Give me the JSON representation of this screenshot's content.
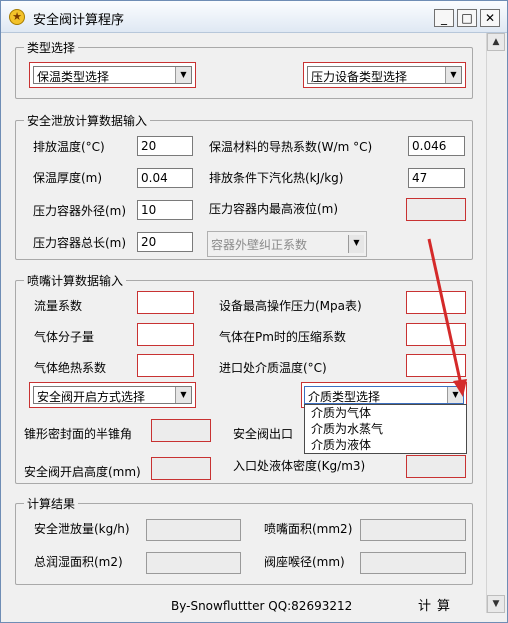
{
  "window": {
    "title": "安全阀计算程序",
    "minimize": "_",
    "maximize": "□",
    "close": "✕"
  },
  "type_group": {
    "title": "类型选择",
    "insulation_combo": "保温类型选择",
    "vessel_combo": "压力设备类型选择"
  },
  "relief_group": {
    "title": "安全泄放计算数据输入",
    "discharge_temp_label": "排放温度(°C)",
    "discharge_temp_value": "20",
    "conductivity_label": "保温材料的导热系数(W/m °C)",
    "conductivity_value": "0.046",
    "insulation_thickness_label": "保温厚度(m)",
    "insulation_thickness_value": "0.04",
    "latent_heat_label": "排放条件下汽化热(kJ/kg)",
    "latent_heat_value": "47",
    "vessel_diameter_label": "压力容器外径(m)",
    "vessel_diameter_value": "10",
    "max_level_label": "压力容器内最高液位(m)",
    "max_level_value": "",
    "vessel_length_label": "压力容器总长(m)",
    "vessel_length_value": "20",
    "correction_combo": "容器外壁纠正系数"
  },
  "nozzle_group": {
    "title": "喷嘴计算数据输入",
    "flow_coef_label": "流量系数",
    "max_pressure_label": "设备最高操作压力(Mpa表)",
    "molecular_weight_label": "气体分子量",
    "compressibility_label": "气体在Pm时的压缩系数",
    "adiabatic_label": "气体绝热系数",
    "inlet_temp_label": "进口处介质温度(°C)",
    "open_mode_combo": "安全阀开启方式选择",
    "medium_combo": "介质类型选择",
    "medium_options": [
      "介质为气体",
      "介质为水蒸气",
      "介质为液体"
    ],
    "cone_angle_label": "锥形密封面的半锥角",
    "outlet_label": "安全阀出口",
    "open_height_label": "安全阀开启高度(mm)",
    "liquid_density_label": "入口处液体密度(Kg/m3)"
  },
  "results_group": {
    "title": "计算结果",
    "relief_amount_label": "安全泄放量(kg/h)",
    "nozzle_area_label": "喷嘴面积(mm2)",
    "wetted_area_label": "总润湿面积(m2)",
    "throat_diameter_label": "阀座喉径(mm)"
  },
  "footer": {
    "credit": "By-Snowfluttter  QQ:82693212",
    "calc_button": "计算"
  },
  "scroll": {
    "up": "▲",
    "down": "▼"
  }
}
